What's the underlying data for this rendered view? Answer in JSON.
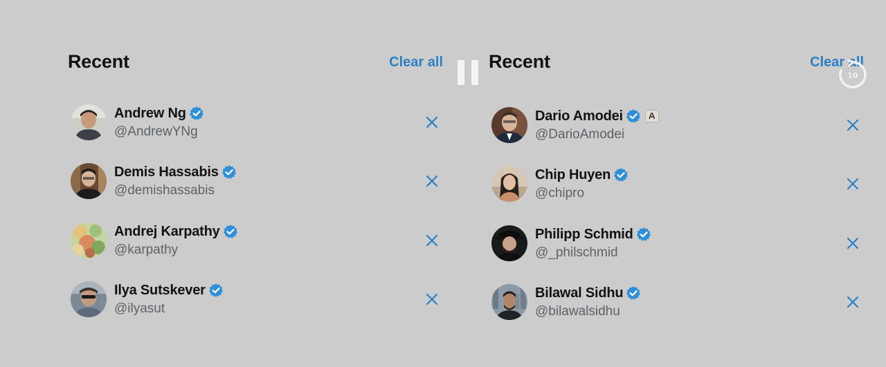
{
  "left_panel": {
    "title": "Recent",
    "clear_all_label": "Clear all",
    "users": [
      {
        "name": "Andrew Ng",
        "handle": "@AndrewYNg"
      },
      {
        "name": "Demis Hassabis",
        "handle": "@demishassabis"
      },
      {
        "name": "Andrej Karpathy",
        "handle": "@karpathy"
      },
      {
        "name": "Ilya Sutskever",
        "handle": "@ilyasut"
      }
    ]
  },
  "right_panel": {
    "title": "Recent",
    "clear_all_label": "Clear all",
    "users": [
      {
        "name": "Dario Amodei",
        "handle": "@DarioAmodei"
      },
      {
        "name": "Chip Huyen",
        "handle": "@chipro"
      },
      {
        "name": "Philipp Schmid",
        "handle": "@_philschmid"
      },
      {
        "name": "Bilawal Sidhu",
        "handle": "@bilawalsidhu"
      }
    ]
  },
  "video_overlay": {
    "pause_icon": "pause-icon",
    "replay_icon": "replay-10-icon",
    "replay_seconds": "10"
  },
  "colors": {
    "background": "#cccccc",
    "accent": "#2b7fc4",
    "verified": "#2f8fd8",
    "text_primary": "#101214",
    "text_secondary": "#5b6268"
  }
}
